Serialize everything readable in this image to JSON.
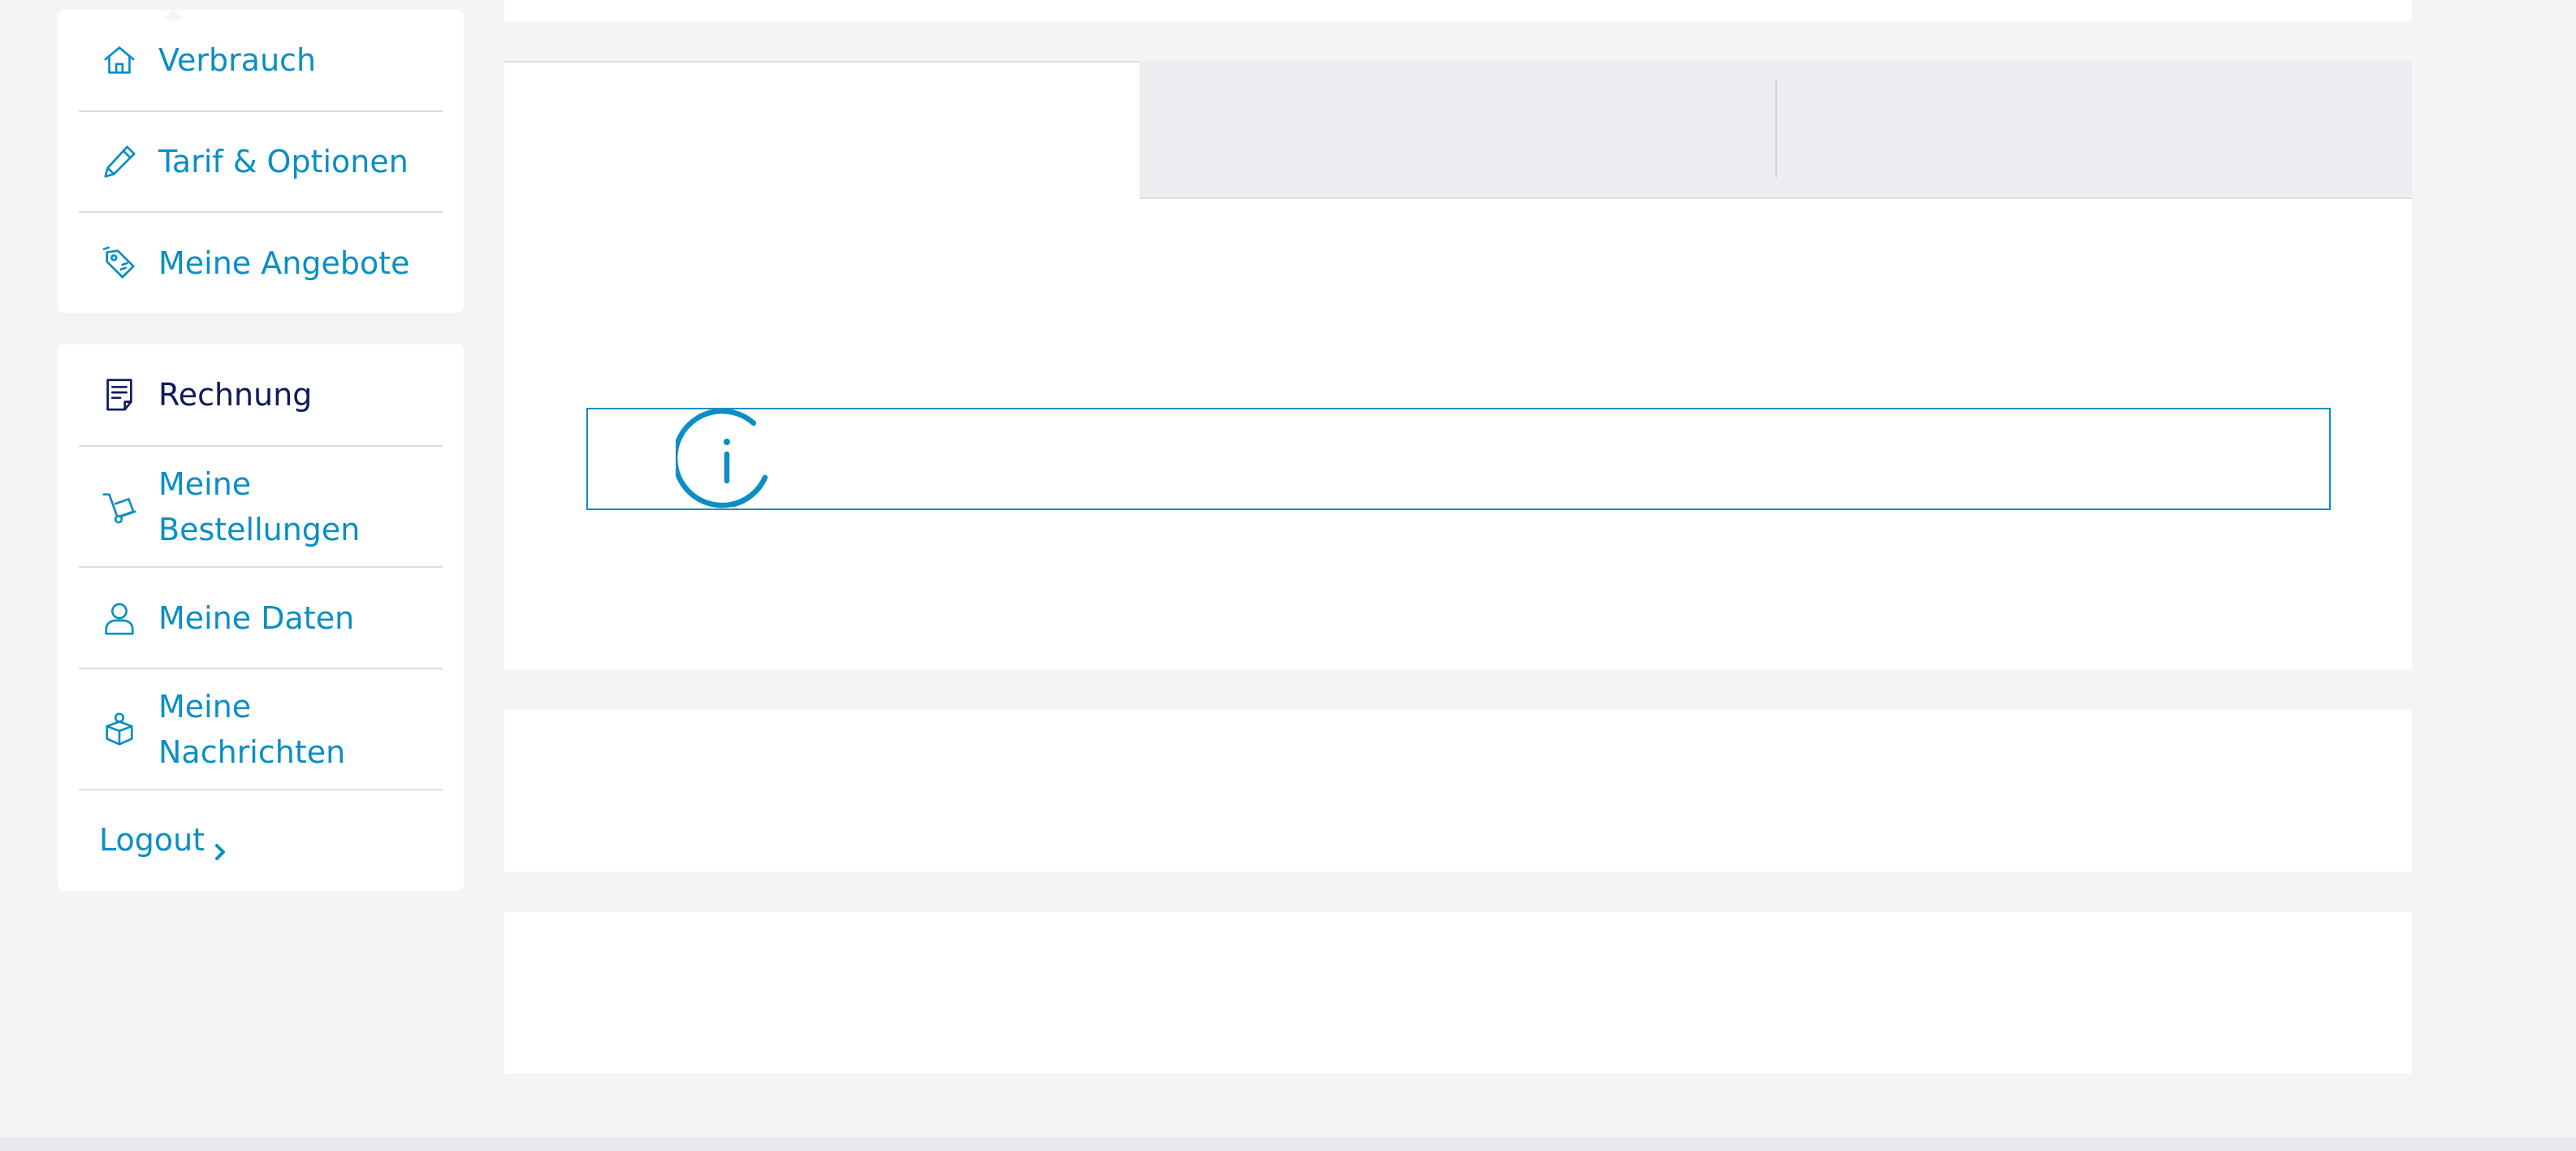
{
  "sidebar": {
    "group1": [
      {
        "label": "Verbrauch",
        "icon": "home-icon"
      },
      {
        "label": "Tarif & Optionen",
        "icon": "pencil-icon"
      },
      {
        "label": "Meine Angebote",
        "icon": "tag-icon"
      }
    ],
    "group2": [
      {
        "label": "Rechnung",
        "icon": "invoice-icon",
        "active": true
      },
      {
        "label": "Meine Bestellungen",
        "icon": "hand-truck-icon"
      },
      {
        "label": "Meine Daten",
        "icon": "user-icon"
      },
      {
        "label": "Meine Nachrichten",
        "icon": "message-box-icon"
      }
    ],
    "logout_label": "Logout"
  },
  "main": {
    "tabs": [
      {
        "label": "",
        "active": true
      },
      {
        "label": "",
        "active": false
      },
      {
        "label": "",
        "active": false
      }
    ],
    "info_icon": "info-icon"
  },
  "colors": {
    "accent": "#0a8ec5",
    "active_text": "#0e1a5c",
    "page_bg": "#f3f4f6",
    "tab_inactive_bg": "#ecedf0",
    "divider": "#d9dde2"
  }
}
